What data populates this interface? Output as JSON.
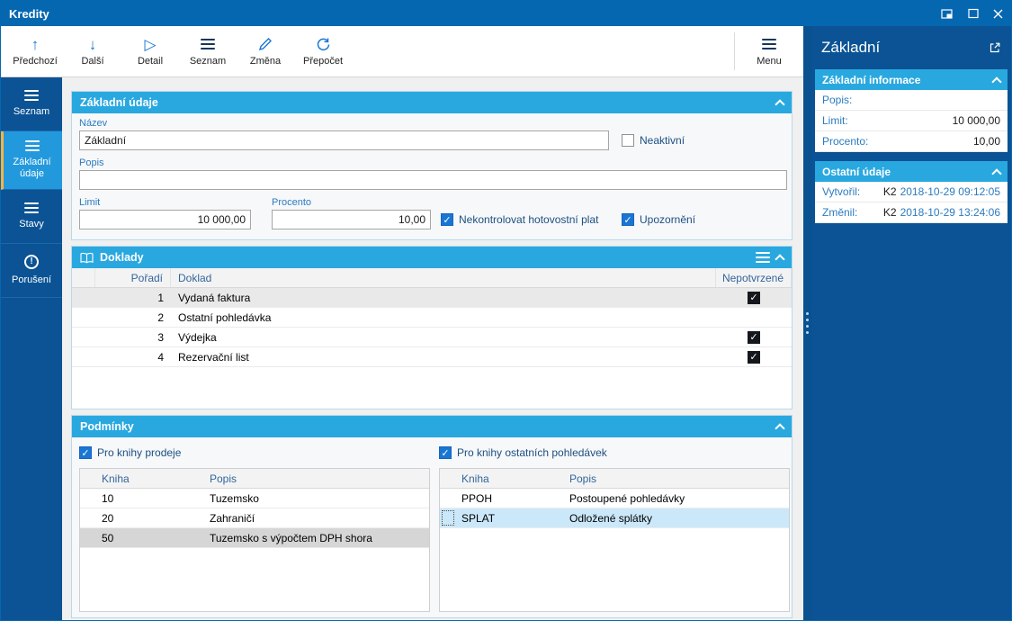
{
  "window": {
    "title": "Kredity"
  },
  "colors": {
    "titlebar": "#0667b1",
    "sidebar": "#0b5394",
    "panel_header": "#29a8e0",
    "label_blue": "#2b7bc0",
    "checkbox_blue": "#1976d2",
    "active_item_accent": "#ffb340"
  },
  "icons": {
    "previous": "↑",
    "next": "↓",
    "detail": "▷",
    "list": "hamburger",
    "edit": "pencil",
    "recalc": "circular-arrow",
    "menu": "hamburger",
    "check": "✓",
    "alert": "!"
  },
  "toolbar": {
    "buttons": [
      {
        "label": "Předchozí",
        "icon": "arrow-up"
      },
      {
        "label": "Další",
        "icon": "arrow-down"
      },
      {
        "label": "Detail",
        "icon": "triangle-right"
      },
      {
        "label": "Seznam",
        "icon": "hamburger"
      },
      {
        "label": "Změna",
        "icon": "pencil"
      },
      {
        "label": "Přepočet",
        "icon": "refresh"
      }
    ],
    "menu": {
      "label": "Menu"
    }
  },
  "sidebar": {
    "items": [
      {
        "label": "Seznam",
        "active": false
      },
      {
        "label": "Základní údaje",
        "active": true
      },
      {
        "label": "Stavy",
        "active": false
      },
      {
        "label": "Porušení",
        "active": false
      }
    ]
  },
  "panels": {
    "zakladni": {
      "title": "Základní údaje",
      "fields": {
        "nazev": {
          "label": "Název",
          "value": "Základní"
        },
        "neaktivni": {
          "label": "Neaktivní",
          "checked": false
        },
        "popis": {
          "label": "Popis",
          "value": ""
        },
        "limit": {
          "label": "Limit",
          "value": "10 000,00"
        },
        "procento": {
          "label": "Procento",
          "value": "10,00"
        },
        "nekontrolovat": {
          "label": "Nekontrolovat hotovostní plat",
          "checked": true
        },
        "upozorneni": {
          "label": "Upozornění",
          "checked": true
        }
      }
    },
    "doklady": {
      "title": "Doklady",
      "columns": [
        "Pořadí",
        "Doklad",
        "Nepotvrzené"
      ],
      "rows": [
        {
          "poradi": "1",
          "doklad": "Vydaná faktura",
          "nepotvrzene": true,
          "selected": true
        },
        {
          "poradi": "2",
          "doklad": "Ostatní pohledávka",
          "nepotvrzene": false,
          "selected": false
        },
        {
          "poradi": "3",
          "doklad": "Výdejka",
          "nepotvrzene": true,
          "selected": false
        },
        {
          "poradi": "4",
          "doklad": "Rezervační list",
          "nepotvrzene": true,
          "selected": false
        }
      ]
    },
    "podminky": {
      "title": "Podmínky",
      "groups": [
        {
          "checkbox_label": "Pro knihy prodeje",
          "checked": true,
          "columns": [
            "Kniha",
            "Popis"
          ],
          "rows": [
            {
              "kniha": "10",
              "popis": "Tuzemsko",
              "cursor": false,
              "selected": false
            },
            {
              "kniha": "20",
              "popis": "Zahraničí",
              "cursor": false,
              "selected": false
            },
            {
              "kniha": "50",
              "popis": "Tuzemsko s výpočtem DPH shora",
              "cursor": true,
              "selected": false
            }
          ]
        },
        {
          "checkbox_label": "Pro knihy ostatních pohledávek",
          "checked": true,
          "columns": [
            "Kniha",
            "Popis"
          ],
          "rows": [
            {
              "kniha": "PPOH",
              "popis": "Postoupené pohledávky",
              "cursor": false,
              "selected": false
            },
            {
              "kniha": "SPLAT",
              "popis": "Odložené splátky",
              "cursor": false,
              "selected": true
            }
          ]
        }
      ]
    }
  },
  "right_panel": {
    "title": "Základní",
    "sections": [
      {
        "title": "Základní informace",
        "rows": [
          {
            "label": "Popis:",
            "value": ""
          },
          {
            "label": "Limit:",
            "value": "10 000,00"
          },
          {
            "label": "Procento:",
            "value": "10,00"
          }
        ]
      },
      {
        "title": "Ostatní údaje",
        "rows": [
          {
            "label": "Vytvořil:",
            "author": "K2",
            "datetime": "2018-10-29 09:12:05"
          },
          {
            "label": "Změnil:",
            "author": "K2",
            "datetime": "2018-10-29 13:24:06"
          }
        ]
      }
    ]
  }
}
